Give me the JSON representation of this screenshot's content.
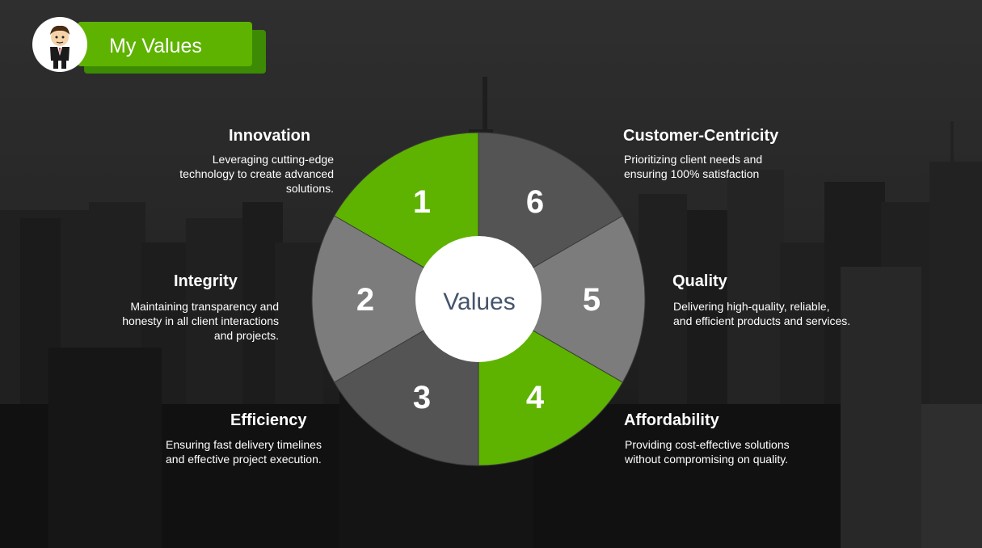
{
  "header": {
    "title": "My Values"
  },
  "center_label": "Values",
  "colors": {
    "green": "#5db300",
    "dark_gray": "#545454",
    "light_gray": "#7c7c7c",
    "white": "#ffffff"
  },
  "segments": [
    {
      "number": "1",
      "color": "green"
    },
    {
      "number": "2",
      "color": "light_gray"
    },
    {
      "number": "3",
      "color": "dark_gray"
    },
    {
      "number": "4",
      "color": "green"
    },
    {
      "number": "5",
      "color": "light_gray"
    },
    {
      "number": "6",
      "color": "dark_gray"
    }
  ],
  "values": [
    {
      "title": "Innovation",
      "description": "Leveraging cutting-edge technology to create advanced solutions."
    },
    {
      "title": "Integrity",
      "description": "Maintaining transparency and honesty in all client interactions and projects."
    },
    {
      "title": "Efficiency",
      "description": "Ensuring fast delivery timelines and effective project execution."
    },
    {
      "title": "Affordability",
      "description": "Providing cost-effective solutions without compromising on quality."
    },
    {
      "title": "Quality",
      "description": "Delivering high-quality, reliable, and efficient products and services."
    },
    {
      "title": "Customer-Centricity",
      "description": "Prioritizing client needs and ensuring 100% satisfaction"
    }
  ]
}
